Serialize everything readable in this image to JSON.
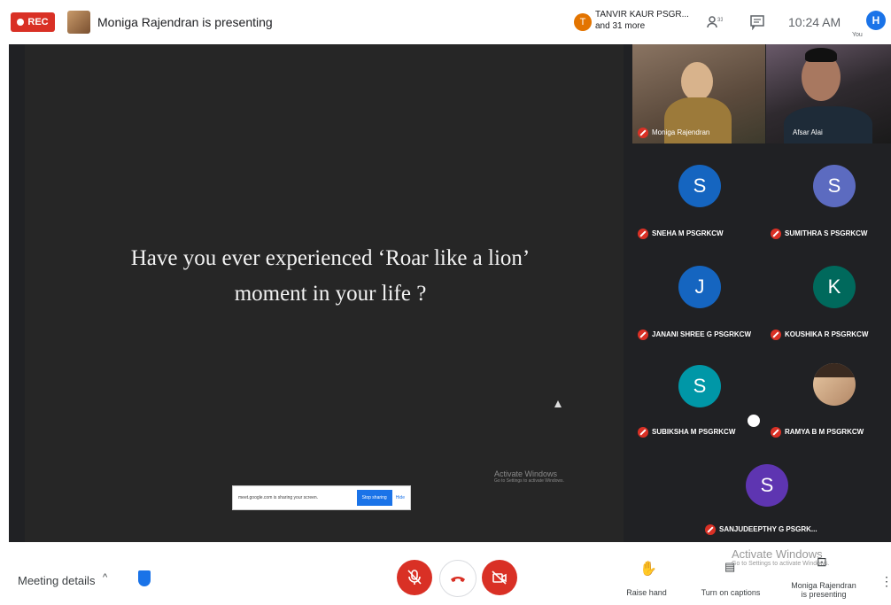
{
  "topbar": {
    "rec_label": "REC",
    "presenting_text": "Moniga Rajendran is presenting",
    "participant_initial": "T",
    "participant_line1": "TANVIR KAUR PSGR...",
    "participant_line2": "and 31 more",
    "time": "10:24 AM",
    "user_initial": "H",
    "you_label": "You"
  },
  "slide": {
    "line1": "Have you ever experienced ‘Roar like a lion’",
    "line2": "moment in your life ?"
  },
  "share_bar": {
    "message": "meet.google.com is sharing your screen.",
    "stop_label": "Stop sharing",
    "hide_label": "Hide"
  },
  "watermark": {
    "title": "Activate Windows",
    "subtitle": "Go to Settings to activate Windows."
  },
  "participants": [
    {
      "name": "Moniga Rajendran"
    },
    {
      "name": "Afsar Alai"
    },
    {
      "name": "SNEHA M PSGRKCW",
      "initial": "S"
    },
    {
      "name": "SUMITHRA S PSGRKCW",
      "initial": "S"
    },
    {
      "name": "JANANI SHREE G PSGRKCW",
      "initial": "J"
    },
    {
      "name": "KOUSHIKA R PSGRKCW",
      "initial": "K"
    },
    {
      "name": "SUBIKSHA M PSGRKCW",
      "initial": "S"
    },
    {
      "name": "RAMYA B M PSGRKCW"
    },
    {
      "name": "SANJUDEEPTHY G PSGRK...",
      "initial": "S"
    }
  ],
  "bottombar": {
    "meeting_details": "Meeting details",
    "raise_hand": "Raise hand",
    "captions": "Turn on captions",
    "presenting_line1": "Moniga Rajendran",
    "presenting_line2": "is presenting",
    "watermark_title": "Activate Windows",
    "watermark_sub": "Go to Settings to activate Windows."
  },
  "colors": {
    "accent": "#1a73e8",
    "danger": "#d93025",
    "avatar_blue": "#1565c0",
    "avatar_indigo": "#5c6bc0",
    "avatar_green": "#00695c",
    "avatar_teal": "#0097a7",
    "avatar_purple": "#5e35b1"
  }
}
